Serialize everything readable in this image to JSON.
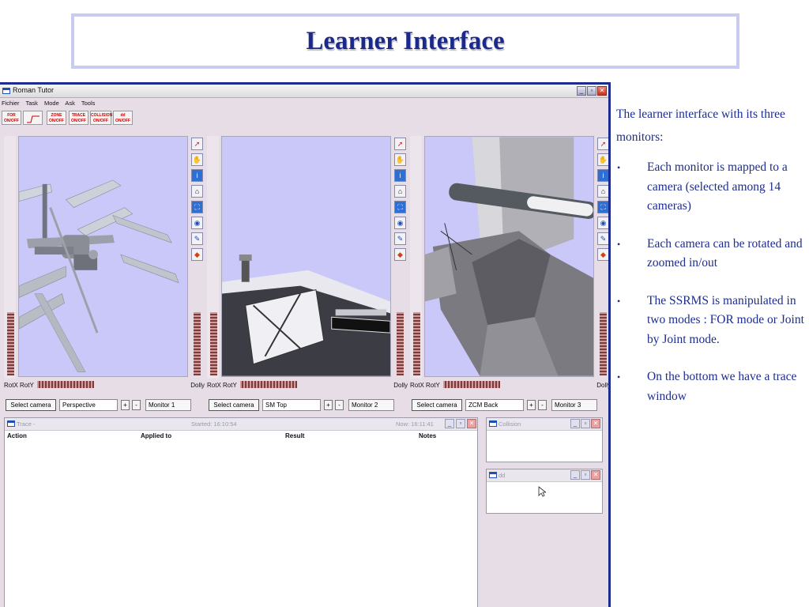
{
  "slide": {
    "title": "Learner Interface",
    "intro": "The learner interface with its three monitors:",
    "bullets": [
      "Each monitor is mapped to a camera (selected among 14 cameras)",
      "Each camera can be rotated and zoomed in/out",
      "The SSRMS is manipulated in two modes : FOR mode or Joint by Joint mode.",
      "On the bottom we have a trace window"
    ]
  },
  "app": {
    "title": "Roman Tutor",
    "menu": [
      "Fichier",
      "Task",
      "Mode",
      "Ask",
      "Tools"
    ],
    "toolbar": [
      {
        "line1": "FOR",
        "line2": "ON/OFF"
      },
      {
        "line1": "",
        "line2": ""
      },
      {
        "line1": "ZONE",
        "line2": "ON/OFF"
      },
      {
        "line1": "TRACE",
        "line2": "ON/OFF"
      },
      {
        "line1": "COLLISION",
        "line2": "ON/OFF"
      },
      {
        "line1": "dd",
        "line2": "ON/OFF"
      }
    ]
  },
  "monitors": [
    {
      "rot_label": "RotX RotY",
      "dolly_label": "Dolly",
      "select_label": "Select camera",
      "camera": "Perspective",
      "plus": "+",
      "minus": "-",
      "monitor_label": "Monitor 1"
    },
    {
      "rot_label": "RotX RotY",
      "dolly_label": "Dolly",
      "select_label": "Select camera",
      "camera": "SM Top",
      "plus": "+",
      "minus": "-",
      "monitor_label": "Monitor 2"
    },
    {
      "rot_label": "RotX RotY",
      "dolly_label": "Dolly",
      "select_label": "Select camera",
      "camera": "ZCM Back",
      "plus": "+",
      "minus": "-",
      "monitor_label": "Monitor 3"
    }
  ],
  "trace": {
    "title": "Trace -",
    "started": "Started: 16:10:54",
    "now": "Now: 16:11:41",
    "columns": [
      "Action",
      "Applied to",
      "Result",
      "Notes"
    ]
  },
  "collision": {
    "title": "Collision"
  },
  "dd": {
    "title": "dd"
  },
  "colors": {
    "slide_text": "#1d2d8f",
    "viewport_bg": "#c9c8f8",
    "app_bg": "#e6dde6"
  }
}
